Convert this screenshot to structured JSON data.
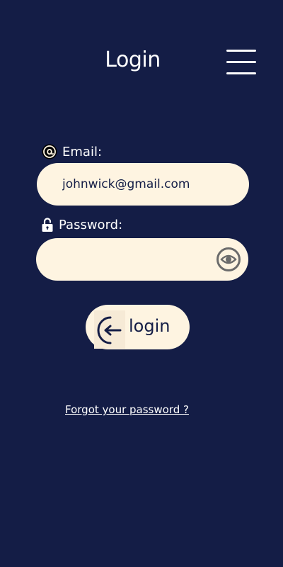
{
  "header": {
    "title": "Login",
    "menu_icon": "hamburger-menu-icon"
  },
  "form": {
    "email": {
      "label": "Email:",
      "icon": "at-sign-icon",
      "value": "johnwick@gmail.com"
    },
    "password": {
      "label": "Password:",
      "icon": "unlocked-padlock-icon",
      "value": "",
      "toggle_icon": "eye-icon"
    },
    "submit": {
      "label": "login",
      "icon": "login-arrow-icon"
    }
  },
  "links": {
    "forgot_password": "Forgot your password ?"
  },
  "colors": {
    "background": "#141d46",
    "field": "#fef4e1",
    "text_dark": "#141d46",
    "text_light": "#ffffff"
  }
}
